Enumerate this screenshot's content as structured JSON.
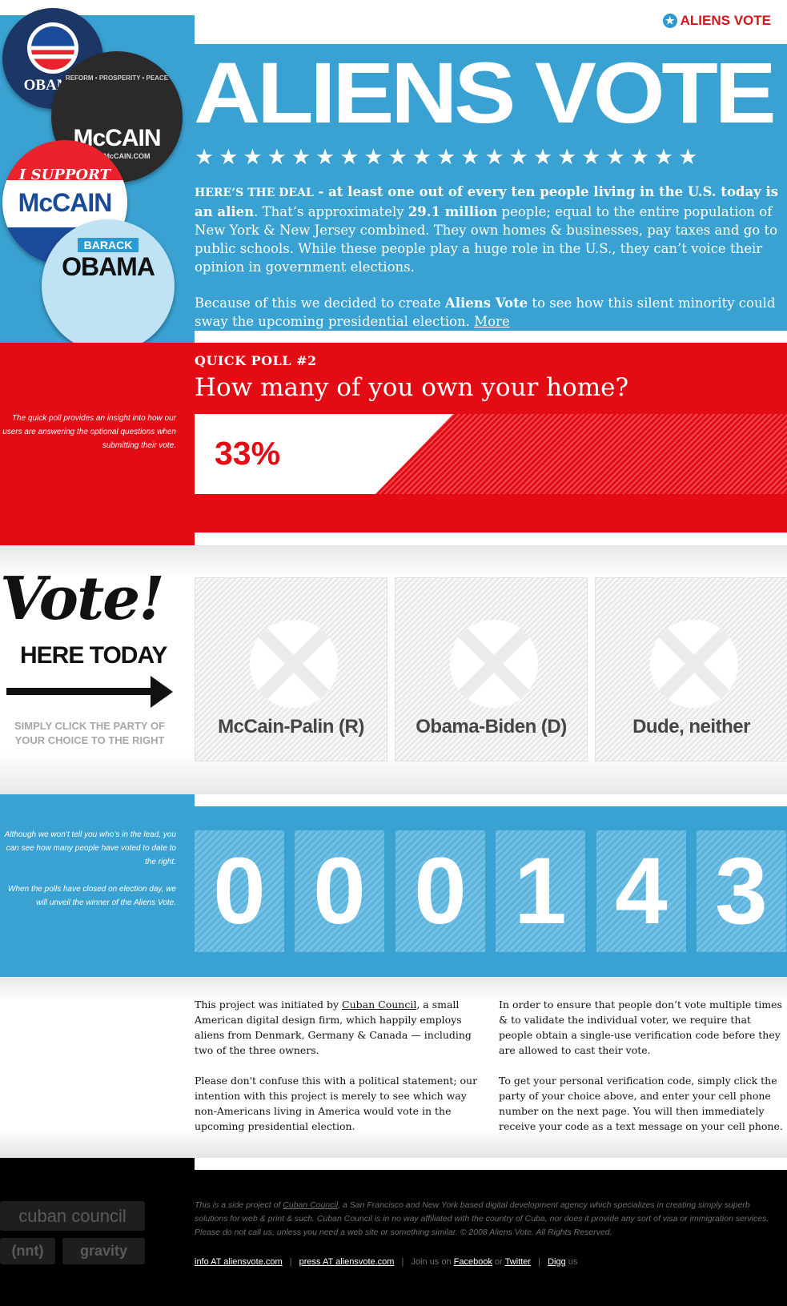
{
  "brand": {
    "name": "ALIENS VOTE",
    "star": "★"
  },
  "hero": {
    "title": "ALIENS VOTE",
    "stars": "★★★★★★★★★★★★★★★★★★★★★",
    "intro_lead": "HERE’S THE DEAL",
    "intro_bold1": " - at least one out of every ten people living in the U.S. today is an alien",
    "intro_text1": ". That’s approximately ",
    "intro_bold2": "29.1 million",
    "intro_text2": " people; equal to the entire population of New York & New Jersey combined. They own homes & businesses, pay taxes and go to public schools. While these people play a huge role in the U.S., they can’t voice their opinion in government elections.",
    "intro2_text1": "Because of this we decided to create ",
    "intro2_bold": "Aliens Vote",
    "intro2_text2": " to see how this silent minority could sway the upcoming presidential election. ",
    "more_link": "More"
  },
  "badges": {
    "obama1": "OBAMA",
    "mccain1_top": "REFORM • PROSPERITY • PEACE",
    "mccain1": "McCAIN",
    "mccain1_url": "JOHNMcCAIN.COM",
    "support_top": "I SUPPORT",
    "support": "McCAIN",
    "obama2_top": "BARACK",
    "obama2": "OBAMA"
  },
  "poll": {
    "side_text": "The quick poll provides an insight into how our users are answering the optional questions when submitting their vote.",
    "kicker": "QUICK POLL #2",
    "question": "How many of you own your home?",
    "value": "33%",
    "fraction": 0.33
  },
  "vote": {
    "word": "Vote!",
    "here": "HERE TODAY",
    "hint": "SIMPLY CLICK THE PARTY OF YOUR CHOICE TO THE RIGHT",
    "choices": [
      {
        "label": "McCain-Palin (R)"
      },
      {
        "label": "Obama-Biden (D)"
      },
      {
        "label": "Dude, neither"
      }
    ]
  },
  "counter": {
    "side_p1": "Although we won’t tell you who’s in the lead, you can see how many people have voted to date to the right.",
    "side_p2": "When the polls have closed on election day, we will unveil the winner of the Aliens Vote.",
    "digits": [
      "0",
      "0",
      "0",
      "1",
      "4",
      "3"
    ]
  },
  "about": {
    "l1_text1": "This project was initiated by ",
    "l1_link": "Cuban Council",
    "l1_text2": ", a small American digital design firm, which happily employs aliens from Denmark, Germany & Canada — including two of the three owners.",
    "l2": "Please don't confuse this with a political statement; our intention with this project is merely to see which way non-Americans living in America would vote in the upcoming presidential election.",
    "r1": "In order to ensure that people don’t vote multiple times & to validate the individual voter, we require that people obtain a single-use verification code before they are allowed to cast their vote.",
    "r2": "To get your personal verification code, simply click the party of your choice above, and enter your cell phone number on the next page. You will then immediately receive your code as a text message on your cell phone."
  },
  "footer": {
    "logo_cuban": "cuban council",
    "logo_nnt": "(nnt)",
    "logo_gravity": "gravity",
    "text1": "This is a side project of ",
    "text_link": "Cuban Council",
    "text2": ", a San Francisco and New York based digital development agency which specializes in creating simply superb solutions for web & print & such. Cuban Council is in no way affiliated with the country of Cuba, nor does it provide any sort of visa or immigration services. Please do not call us, unless you need a web site or something similar. © 2008 Aliens Vote. All Rights Reserved.",
    "link_info": "info AT aliensvote.com",
    "link_press": "press AT aliensvote.com",
    "join": "Join us on",
    "link_facebook": "Facebook",
    "or": "or",
    "link_twitter": "Twitter",
    "link_digg": "Digg",
    "us": "us",
    "sep": "|"
  },
  "colors": {
    "blue": "#3aa2d2",
    "red": "#e30b14",
    "black": "#000000"
  }
}
